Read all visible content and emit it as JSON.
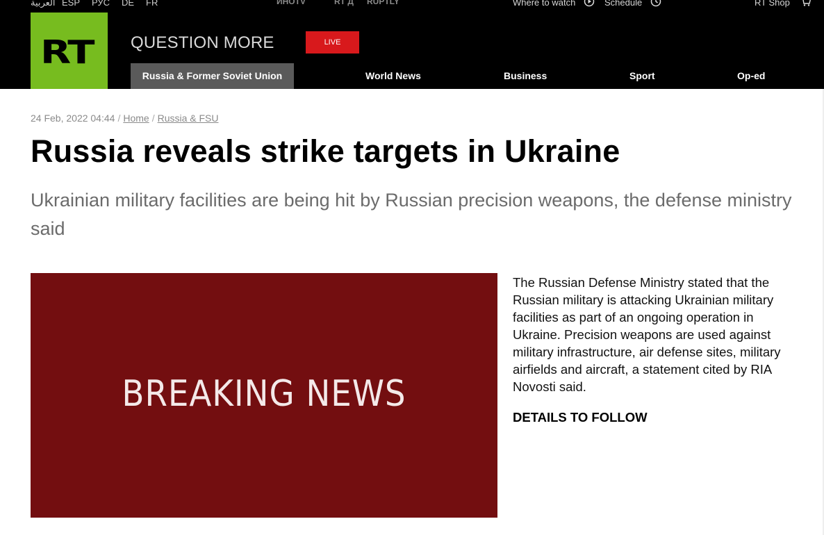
{
  "topbar": {
    "languages": [
      "العربية",
      "ESP",
      "РУС",
      "DE",
      "FR"
    ],
    "brands": [
      "ИНОTV",
      "RT Д",
      "RUPTLY"
    ],
    "where_to_watch": "Where to watch",
    "schedule": "Schedule",
    "shop": "RT Shop"
  },
  "header": {
    "logo": "RT",
    "slogan": "QUESTION MORE",
    "live": "LIVE",
    "nav": [
      "Russia & Former Soviet Union",
      "World News",
      "Business",
      "Sport",
      "Op-ed"
    ]
  },
  "article": {
    "date": "24 Feb, 2022 04:44",
    "breadcrumb": [
      "Home",
      "Russia & FSU"
    ],
    "headline": "Russia reveals strike targets in Ukraine",
    "subheadline": "Ukrainian military facilities are being hit by Russian precision weapons, the defense ministry said",
    "image_text": "BREAKING NEWS",
    "body": "The Russian Defense Ministry stated that the Russian military is attacking Ukrainian military facilities as part of an ongoing operation in Ukraine. Precision weapons are used against military infrastructure, air defense sites, military airfields and aircraft, a statement cited by RIA Novosti said.",
    "details": "DETAILS TO FOLLOW"
  },
  "colors": {
    "logo_green": "#77bc1f",
    "live_red": "#d8191c",
    "breaking_bg": "#730e10",
    "active_nav": "#5a5a5a"
  }
}
